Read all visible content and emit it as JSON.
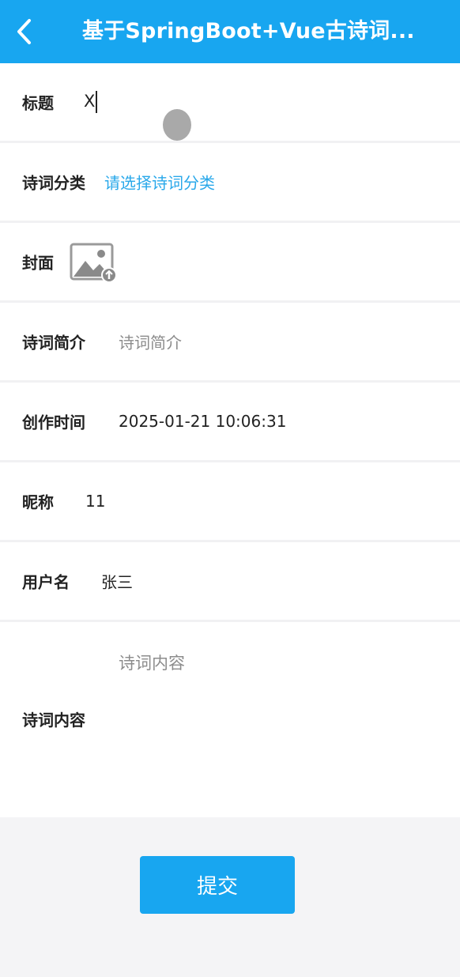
{
  "header": {
    "title": "基于SpringBoot+Vue古诗词...",
    "back_icon": "chevron-left-icon",
    "background": "#18a6f0"
  },
  "form": {
    "title": {
      "label": "标题",
      "value": "X"
    },
    "category": {
      "label": "诗词分类",
      "placeholder": "请选择诗词分类"
    },
    "cover": {
      "label": "封面",
      "upload_icon": "image-upload-icon"
    },
    "intro": {
      "label": "诗词简介",
      "placeholder": "诗词简介"
    },
    "created_time": {
      "label": "创作时间",
      "value": "2025-01-21 10:06:31"
    },
    "nickname": {
      "label": "昵称",
      "value": "11"
    },
    "username": {
      "label": "用户名",
      "value": "张三"
    },
    "content": {
      "label": "诗词内容",
      "placeholder": "诗词内容"
    }
  },
  "submit_label": "提交",
  "colors": {
    "accent": "#18a6f0",
    "link": "#29a8ea",
    "placeholder": "#8c8c8c"
  }
}
